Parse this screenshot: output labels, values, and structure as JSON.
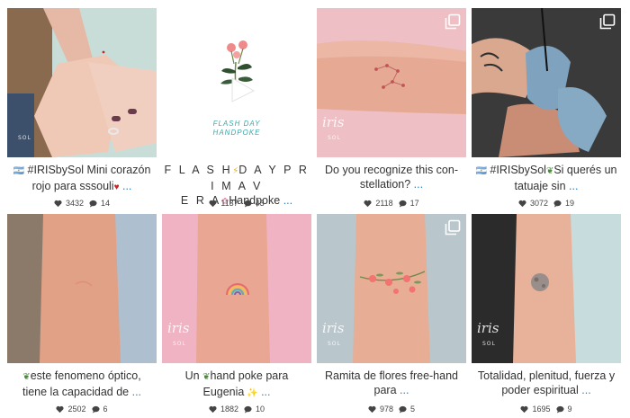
{
  "posts": [
    {
      "caption": "#IRISbySol Mini corazón rojo para sssouli",
      "caption_parts": [
        "🇦🇷 ",
        "#IRISbySol Mini corazón rojo para sssouli",
        " ❤️",
        " ..."
      ],
      "likes": "3432",
      "comments": "14",
      "multi": false,
      "watermark": ""
    },
    {
      "caption": "FLASHDAYPRIMAVERAHandpoke",
      "caption_parts": [
        "F L A S H",
        "⚡",
        "D A Y P R I M A V E R A",
        "🌸",
        "Handpoke",
        " ..."
      ],
      "likes": "1137",
      "comments": "43",
      "multi": false,
      "watermark": "",
      "flash_title": "FLASH DAY",
      "flash_sub": "HANDPOKE"
    },
    {
      "caption": "Do you recognize this con-stellation?",
      "caption_parts": [
        "Do you recognize this con-stellation?",
        " ..."
      ],
      "likes": "2118",
      "comments": "17",
      "multi": true,
      "watermark": "iris SOL"
    },
    {
      "caption": "#IRISbySol Si querés un tatuaje sin",
      "caption_parts": [
        "🇦🇷 ",
        "#IRISbySol",
        " 🌿 ",
        "Si querés un tatuaje sin",
        " ..."
      ],
      "likes": "3072",
      "comments": "19",
      "multi": true,
      "watermark": ""
    },
    {
      "caption": "este fenomeno óptico, tiene la capacidad de",
      "caption_parts": [
        "🌿",
        "este fenomeno óptico, tiene la capacidad de",
        " ..."
      ],
      "likes": "2502",
      "comments": "6",
      "multi": false,
      "watermark": ""
    },
    {
      "caption": "Un hand poke para Eugenia",
      "caption_parts": [
        "Un ",
        "🌿",
        "hand poke para Eugenia",
        " ✨",
        " ..."
      ],
      "likes": "1882",
      "comments": "10",
      "multi": false,
      "watermark": "iris SOL"
    },
    {
      "caption": "Ramita de flores free-hand para",
      "caption_parts": [
        "Ramita de flores free-hand para",
        " ..."
      ],
      "likes": "978",
      "comments": "5",
      "multi": true,
      "watermark": "iris SOL"
    },
    {
      "caption": "Totalidad, plenitud, fuerza y poder espiritual",
      "caption_parts": [
        "Totalidad, plenitud, fuerza y poder espiritual",
        " ..."
      ],
      "likes": "1695",
      "comments": "9",
      "multi": false,
      "watermark": "iris SOL"
    }
  ],
  "icons": {
    "likes": "heart-icon",
    "comments": "comment-icon",
    "multi": "multiple-images-icon"
  },
  "colors": {
    "link": "#2a7fbf",
    "text": "#333333",
    "stats": "#444444"
  }
}
